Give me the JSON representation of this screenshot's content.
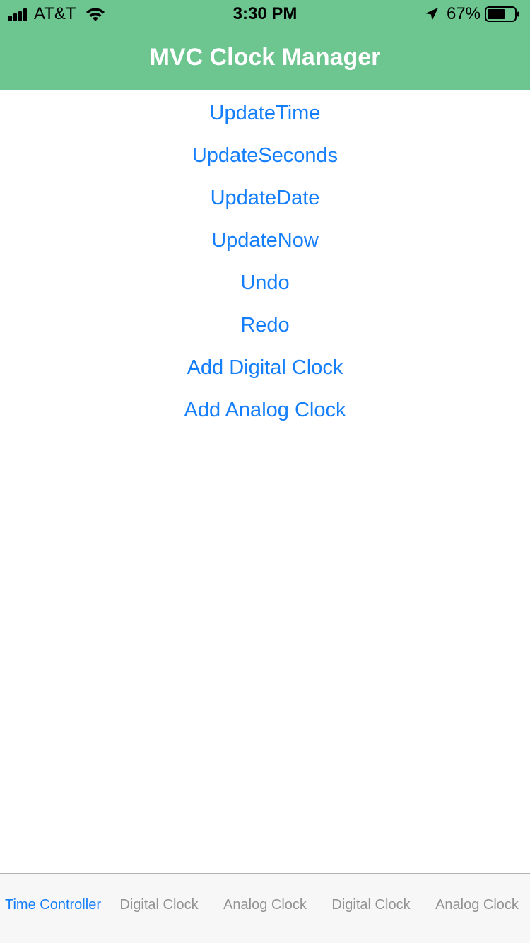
{
  "status_bar": {
    "carrier": "AT&T",
    "time": "3:30 PM",
    "battery_percent": "67%",
    "battery_level": 0.67,
    "signal_bars": 4,
    "icons": [
      "signal-bars-icon",
      "wifi-icon",
      "location-arrow-icon",
      "battery-icon"
    ]
  },
  "nav": {
    "title": "MVC Clock Manager",
    "bar_color": "#6dc590"
  },
  "menu": {
    "accent_color": "#147efb",
    "items": [
      {
        "label": "UpdateTime"
      },
      {
        "label": "UpdateSeconds"
      },
      {
        "label": "UpdateDate"
      },
      {
        "label": "UpdateNow"
      },
      {
        "label": "Undo"
      },
      {
        "label": "Redo"
      },
      {
        "label": "Add Digital Clock"
      },
      {
        "label": "Add Analog Clock"
      }
    ]
  },
  "tab_bar": {
    "selected_index": 0,
    "tabs": [
      {
        "label": "Time Controller"
      },
      {
        "label": "Digital Clock"
      },
      {
        "label": "Analog Clock"
      },
      {
        "label": "Digital Clock"
      },
      {
        "label": "Analog Clock"
      }
    ]
  }
}
